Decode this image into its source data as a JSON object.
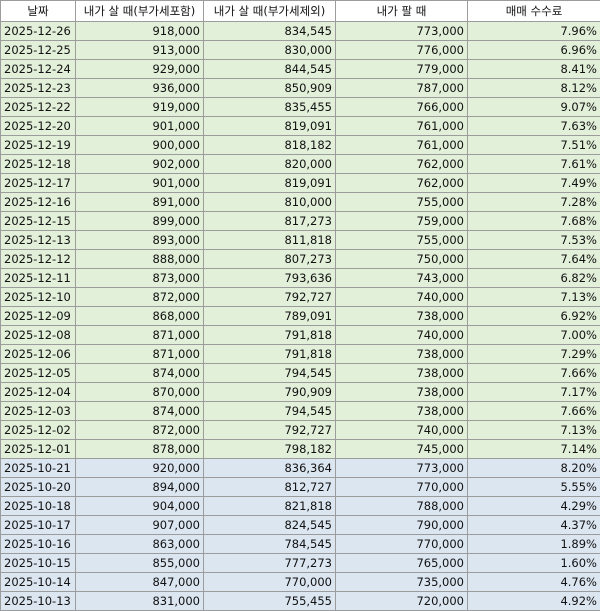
{
  "headers": [
    "날짜",
    "내가 살 때(부가세포함)",
    "내가 살 때(부가세제외)",
    "내가 팔 때",
    "매매 수수료"
  ],
  "rows": [
    {
      "date": "2025-12-26",
      "buy_incl": "918,000",
      "buy_excl": "834,545",
      "sell": "773,000",
      "fee": "7.96%",
      "group": "green"
    },
    {
      "date": "2025-12-25",
      "buy_incl": "913,000",
      "buy_excl": "830,000",
      "sell": "776,000",
      "fee": "6.96%",
      "group": "green"
    },
    {
      "date": "2025-12-24",
      "buy_incl": "929,000",
      "buy_excl": "844,545",
      "sell": "779,000",
      "fee": "8.41%",
      "group": "green"
    },
    {
      "date": "2025-12-23",
      "buy_incl": "936,000",
      "buy_excl": "850,909",
      "sell": "787,000",
      "fee": "8.12%",
      "group": "green"
    },
    {
      "date": "2025-12-22",
      "buy_incl": "919,000",
      "buy_excl": "835,455",
      "sell": "766,000",
      "fee": "9.07%",
      "group": "green"
    },
    {
      "date": "2025-12-20",
      "buy_incl": "901,000",
      "buy_excl": "819,091",
      "sell": "761,000",
      "fee": "7.63%",
      "group": "green"
    },
    {
      "date": "2025-12-19",
      "buy_incl": "900,000",
      "buy_excl": "818,182",
      "sell": "761,000",
      "fee": "7.51%",
      "group": "green"
    },
    {
      "date": "2025-12-18",
      "buy_incl": "902,000",
      "buy_excl": "820,000",
      "sell": "762,000",
      "fee": "7.61%",
      "group": "green"
    },
    {
      "date": "2025-12-17",
      "buy_incl": "901,000",
      "buy_excl": "819,091",
      "sell": "762,000",
      "fee": "7.49%",
      "group": "green"
    },
    {
      "date": "2025-12-16",
      "buy_incl": "891,000",
      "buy_excl": "810,000",
      "sell": "755,000",
      "fee": "7.28%",
      "group": "green"
    },
    {
      "date": "2025-12-15",
      "buy_incl": "899,000",
      "buy_excl": "817,273",
      "sell": "759,000",
      "fee": "7.68%",
      "group": "green"
    },
    {
      "date": "2025-12-13",
      "buy_incl": "893,000",
      "buy_excl": "811,818",
      "sell": "755,000",
      "fee": "7.53%",
      "group": "green"
    },
    {
      "date": "2025-12-12",
      "buy_incl": "888,000",
      "buy_excl": "807,273",
      "sell": "750,000",
      "fee": "7.64%",
      "group": "green"
    },
    {
      "date": "2025-12-11",
      "buy_incl": "873,000",
      "buy_excl": "793,636",
      "sell": "743,000",
      "fee": "6.82%",
      "group": "green"
    },
    {
      "date": "2025-12-10",
      "buy_incl": "872,000",
      "buy_excl": "792,727",
      "sell": "740,000",
      "fee": "7.13%",
      "group": "green"
    },
    {
      "date": "2025-12-09",
      "buy_incl": "868,000",
      "buy_excl": "789,091",
      "sell": "738,000",
      "fee": "6.92%",
      "group": "green"
    },
    {
      "date": "2025-12-08",
      "buy_incl": "871,000",
      "buy_excl": "791,818",
      "sell": "740,000",
      "fee": "7.00%",
      "group": "green"
    },
    {
      "date": "2025-12-06",
      "buy_incl": "871,000",
      "buy_excl": "791,818",
      "sell": "738,000",
      "fee": "7.29%",
      "group": "green"
    },
    {
      "date": "2025-12-05",
      "buy_incl": "874,000",
      "buy_excl": "794,545",
      "sell": "738,000",
      "fee": "7.66%",
      "group": "green"
    },
    {
      "date": "2025-12-04",
      "buy_incl": "870,000",
      "buy_excl": "790,909",
      "sell": "738,000",
      "fee": "7.17%",
      "group": "green"
    },
    {
      "date": "2025-12-03",
      "buy_incl": "874,000",
      "buy_excl": "794,545",
      "sell": "738,000",
      "fee": "7.66%",
      "group": "green"
    },
    {
      "date": "2025-12-02",
      "buy_incl": "872,000",
      "buy_excl": "792,727",
      "sell": "740,000",
      "fee": "7.13%",
      "group": "green"
    },
    {
      "date": "2025-12-01",
      "buy_incl": "878,000",
      "buy_excl": "798,182",
      "sell": "745,000",
      "fee": "7.14%",
      "group": "green"
    },
    {
      "date": "2025-10-21",
      "buy_incl": "920,000",
      "buy_excl": "836,364",
      "sell": "773,000",
      "fee": "8.20%",
      "group": "blue"
    },
    {
      "date": "2025-10-20",
      "buy_incl": "894,000",
      "buy_excl": "812,727",
      "sell": "770,000",
      "fee": "5.55%",
      "group": "blue"
    },
    {
      "date": "2025-10-18",
      "buy_incl": "904,000",
      "buy_excl": "821,818",
      "sell": "788,000",
      "fee": "4.29%",
      "group": "blue"
    },
    {
      "date": "2025-10-17",
      "buy_incl": "907,000",
      "buy_excl": "824,545",
      "sell": "790,000",
      "fee": "4.37%",
      "group": "blue"
    },
    {
      "date": "2025-10-16",
      "buy_incl": "863,000",
      "buy_excl": "784,545",
      "sell": "770,000",
      "fee": "1.89%",
      "group": "blue"
    },
    {
      "date": "2025-10-15",
      "buy_incl": "855,000",
      "buy_excl": "777,273",
      "sell": "765,000",
      "fee": "1.60%",
      "group": "blue"
    },
    {
      "date": "2025-10-14",
      "buy_incl": "847,000",
      "buy_excl": "770,000",
      "sell": "735,000",
      "fee": "4.76%",
      "group": "blue"
    },
    {
      "date": "2025-10-13",
      "buy_incl": "831,000",
      "buy_excl": "755,455",
      "sell": "720,000",
      "fee": "4.92%",
      "group": "blue"
    }
  ],
  "colors": {
    "green_fill": "#e2efd9",
    "blue_fill": "#dce6f1",
    "grid": "#9c9c9c"
  }
}
